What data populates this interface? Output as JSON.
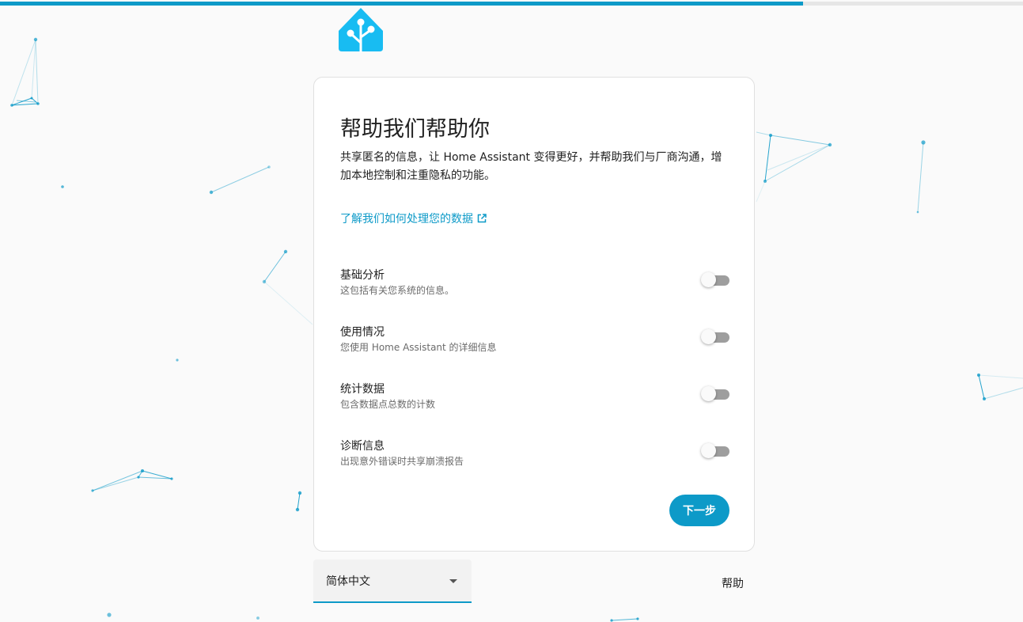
{
  "colors": {
    "accent": "#0d9ac8",
    "logo": "#18bcf2",
    "background": "#fafafa",
    "toggle_off": "#9e9e9e"
  },
  "progress": {
    "fraction": 0.785
  },
  "logo": {
    "icon": "home-assistant-logo-icon"
  },
  "card": {
    "title": "帮助我们帮助你",
    "description": "共享匿名的信息，让 Home Assistant 变得更好，并帮助我们与厂商沟通，增加本地控制和注重隐私的功能。",
    "learn_more": "了解我们如何处理您的数据",
    "learn_more_icon": "open-in-new-icon",
    "settings": [
      {
        "label": "基础分析",
        "description": "这包括有关您系统的信息。",
        "enabled": false
      },
      {
        "label": "使用情况",
        "description": "您使用 Home Assistant 的详细信息",
        "enabled": false
      },
      {
        "label": "统计数据",
        "description": "包含数据点总数的计数",
        "enabled": false
      },
      {
        "label": "诊断信息",
        "description": "出现意外错误时共享崩溃报告",
        "enabled": false
      }
    ],
    "next_button": "下一步"
  },
  "footer": {
    "language": "简体中文",
    "dropdown_icon": "arrow-drop-down-icon",
    "help": "帮助"
  }
}
